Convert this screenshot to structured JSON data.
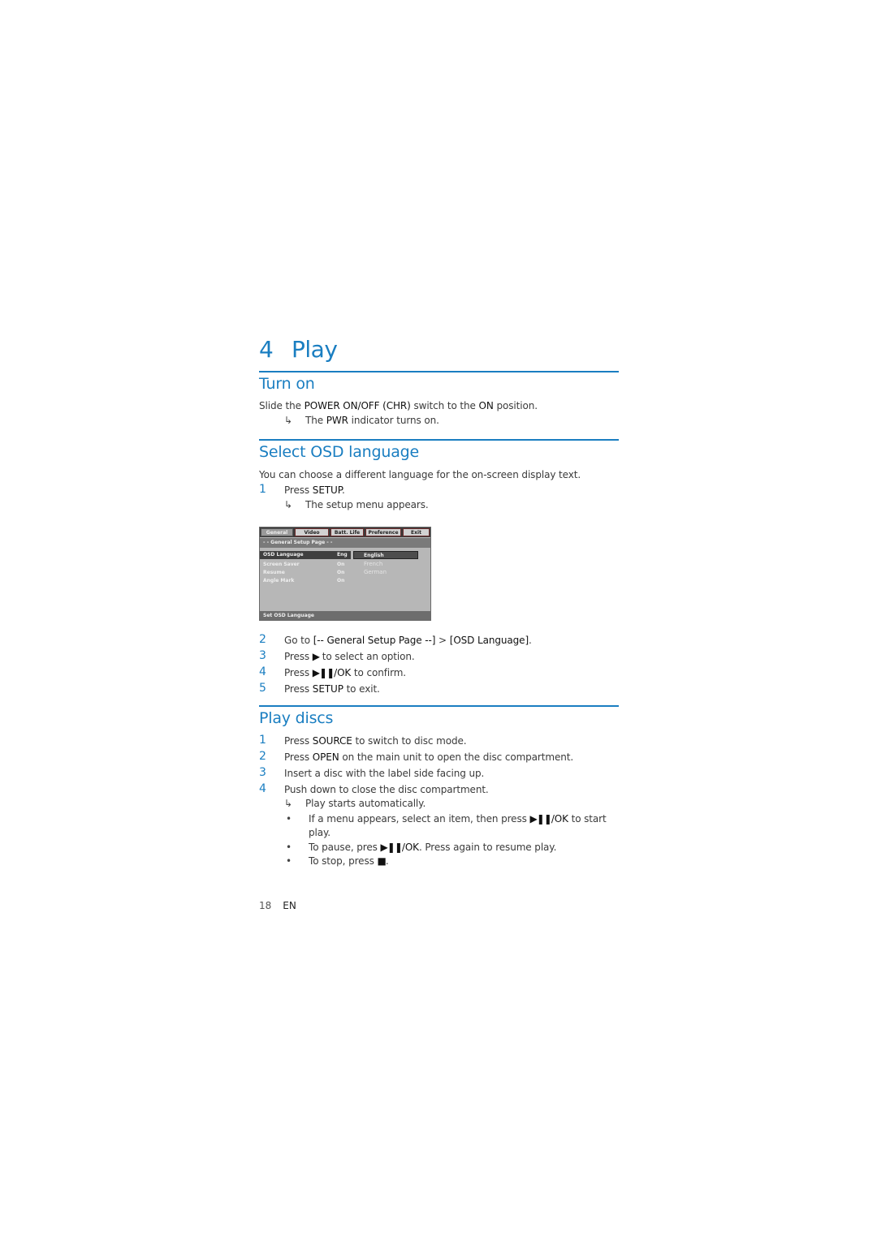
{
  "chapter": {
    "number": "4",
    "title": "Play"
  },
  "sections": {
    "turn_on": {
      "title": "Turn on",
      "intro": {
        "pre": "Slide the ",
        "k1": "POWER ON/OFF (CHR)",
        "mid": " switch to the ",
        "k2": "ON",
        "post": " position."
      },
      "result": {
        "pre": "The ",
        "k": "PWR",
        "post": " indicator turns on."
      }
    },
    "osd_language": {
      "title": "Select OSD language",
      "intro": "You can choose a different language for the on-screen display text.",
      "steps": [
        {
          "num": "1",
          "pre": "Press ",
          "k": "SETUP",
          "post": "."
        },
        {
          "num": "2",
          "pre": "Go to ",
          "k": "[-- General Setup Page --]",
          "mid": " > ",
          "k2": "[OSD Language]",
          "post": "."
        },
        {
          "num": "3",
          "pre": "Press ",
          "sym": "▶",
          "post": " to select an option."
        },
        {
          "num": "4",
          "pre": "Press ",
          "sym": "▶❚❚",
          "k": "/OK",
          "post": " to confirm."
        },
        {
          "num": "5",
          "pre": "Press ",
          "k": "SETUP",
          "post": " to exit."
        }
      ],
      "step1_result": "The setup menu appears.",
      "osd_screen": {
        "tabs": [
          "General",
          "Video",
          "Batt. Life",
          "Preference",
          "Exit"
        ],
        "active_tab": "General",
        "header": "- -   General  Setup  Page   - -",
        "rows": [
          {
            "label": "OSD Language",
            "value": "Eng",
            "selected": true
          },
          {
            "label": "Screen Saver",
            "value": "On"
          },
          {
            "label": "Resume",
            "value": "On"
          },
          {
            "label": "Angle Mark",
            "value": "On"
          }
        ],
        "options": [
          "English",
          "French",
          "German"
        ],
        "selected_option": "English",
        "footer": "Set OSD Language"
      }
    },
    "play_discs": {
      "title": "Play discs",
      "steps": [
        {
          "num": "1",
          "pre": "Press ",
          "k": "SOURCE",
          "post": " to switch to disc mode."
        },
        {
          "num": "2",
          "pre": "Press ",
          "k": "OPEN",
          "post": " on the main unit to open the disc compartment."
        },
        {
          "num": "3",
          "pre": "Insert a disc with the label side facing up.",
          "k": "",
          "post": ""
        },
        {
          "num": "4",
          "pre": "Push down to close the disc compartment.",
          "k": "",
          "post": ""
        }
      ],
      "step4_result": "Play starts automatically.",
      "bullets": [
        {
          "pre": "If a menu appears, select an item, then press ",
          "sym": "▶❚❚",
          "k": "/OK",
          "post": " to start",
          "cont": "play."
        },
        {
          "pre": "To pause, pres ",
          "sym": "▶❚❚",
          "k": "/OK",
          "post": ". Press again to resume play."
        },
        {
          "pre": "To stop, press ",
          "sym": "■",
          "post": "."
        }
      ]
    }
  },
  "footer": {
    "page_number": "18",
    "language": "EN"
  },
  "icons": {
    "result_arrow": "↳",
    "bullet": "•"
  },
  "colors": {
    "accent": "#1a7ec1"
  }
}
